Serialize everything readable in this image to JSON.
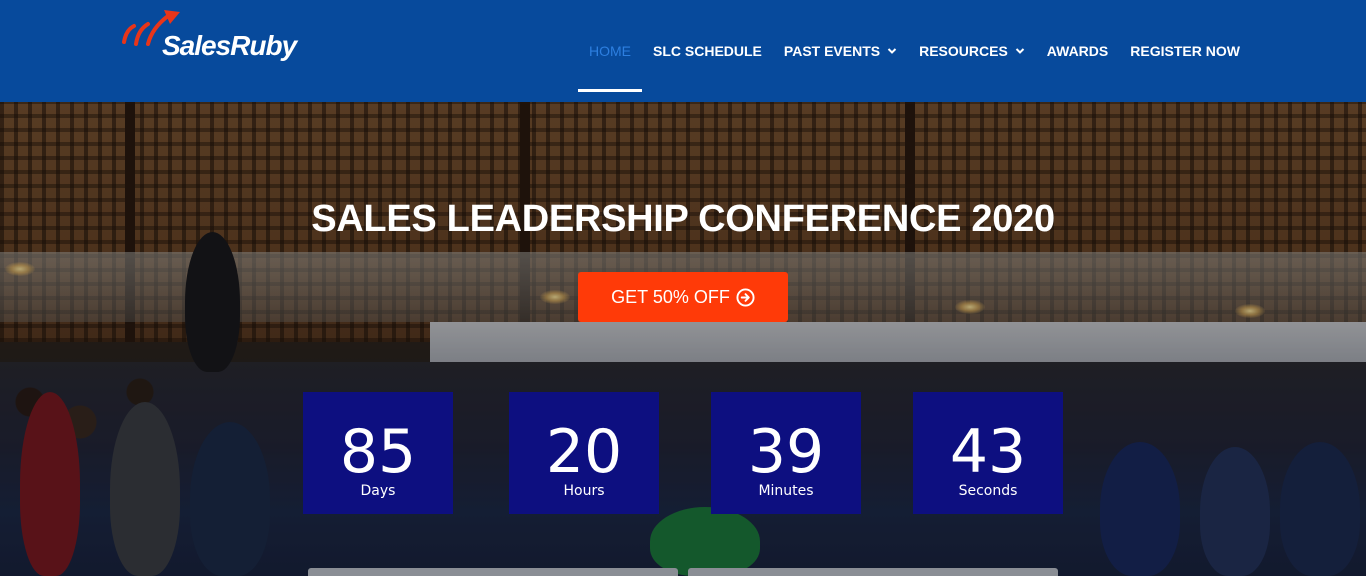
{
  "header": {
    "logo_text": "SalesRuby",
    "nav": [
      {
        "label": "HOME",
        "active": true,
        "dropdown": false
      },
      {
        "label": "SLC SCHEDULE",
        "active": false,
        "dropdown": false
      },
      {
        "label": "PAST EVENTS",
        "active": false,
        "dropdown": true
      },
      {
        "label": "RESOURCES",
        "active": false,
        "dropdown": true
      },
      {
        "label": "AWARDS",
        "active": false,
        "dropdown": false
      },
      {
        "label": "REGISTER NOW",
        "active": false,
        "dropdown": false
      }
    ]
  },
  "hero": {
    "title": "SALES LEADERSHIP CONFERENCE 2020",
    "cta_label": "GET 50% OFF",
    "cta_icon": "circle-arrow-right-icon",
    "countdown": [
      {
        "value": "85",
        "unit": "Days"
      },
      {
        "value": "20",
        "unit": "Hours"
      },
      {
        "value": "39",
        "unit": "Minutes"
      },
      {
        "value": "43",
        "unit": "Seconds"
      }
    ]
  },
  "colors": {
    "header_bg": "#074a9c",
    "nav_active": "#2d7fe0",
    "cta_bg": "#ff3a08",
    "countdown_bg": "#0d0f80",
    "logo_accent": "#e8351a"
  }
}
